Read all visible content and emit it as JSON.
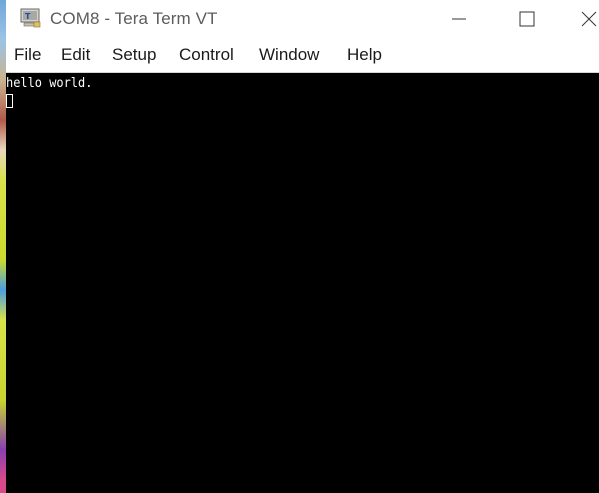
{
  "window": {
    "title": "COM8 - Tera Term VT",
    "icon": "tera-term-app-icon",
    "controls": [
      "minimize-icon",
      "maximize-icon",
      "close-icon"
    ]
  },
  "menu": {
    "items": [
      {
        "label": "File"
      },
      {
        "label": "Edit"
      },
      {
        "label": "Setup"
      },
      {
        "label": "Control"
      },
      {
        "label": "Window"
      },
      {
        "label": "Help"
      }
    ]
  },
  "terminal": {
    "lines": [
      "hello world."
    ],
    "background": "#000000",
    "foreground": "#ffffff"
  }
}
